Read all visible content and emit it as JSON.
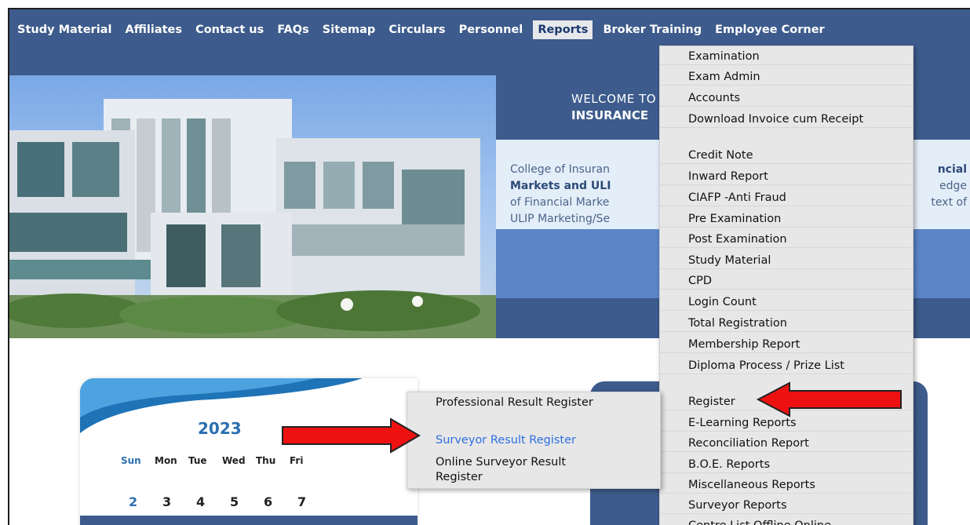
{
  "nav": {
    "items": [
      "Study Material",
      "Affiliates",
      "Contact us",
      "FAQs",
      "Sitemap",
      "Circulars",
      "Personnel",
      "Reports",
      "Broker Training",
      "Employee Corner"
    ],
    "active_index": 7
  },
  "welcome": {
    "line1": "WELCOME TO",
    "line2": "INSURANCE"
  },
  "info": {
    "line1_a": "College of Insuran",
    "line1_b": "ncial",
    "line2_a": "Markets and ULI",
    "line2_b": "edge",
    "line3_a": "of Financial Marke",
    "line3_b": "text of",
    "line4_a": "ULIP Marketing/Se"
  },
  "calendar": {
    "year": "2023",
    "days": [
      "Sun",
      "Mon",
      "Tue",
      "Wed",
      "Thu",
      "Fri"
    ],
    "dates": [
      "2",
      "3",
      "4",
      "5",
      "6",
      "7"
    ]
  },
  "reports_menu": [
    "Examination",
    "Exam Admin",
    "Accounts",
    "Download Invoice cum Receipt",
    "Credit Note",
    "Inward Report",
    "CIAFP -Anti Fraud",
    "Pre Examination",
    "Post Examination",
    "Study Material",
    "CPD",
    "Login Count",
    "Total Registration",
    "Membership Report",
    "Diploma Process / Prize List",
    "Register",
    "E-Learning Reports",
    "Reconciliation Report",
    "B.O.E. Reports",
    "Miscellaneous Reports",
    "Surveyor Reports",
    "Centre List Offline Online"
  ],
  "register_submenu": [
    "Professional Result Register",
    "Surveyor Result Register",
    "Online Surveyor Result Register"
  ],
  "colors": {
    "nav_bg": "#3d5b8c",
    "menu_bg": "#e7e7e7",
    "highlight_link": "#2f6fe0",
    "arrow_red": "#ee1111"
  }
}
